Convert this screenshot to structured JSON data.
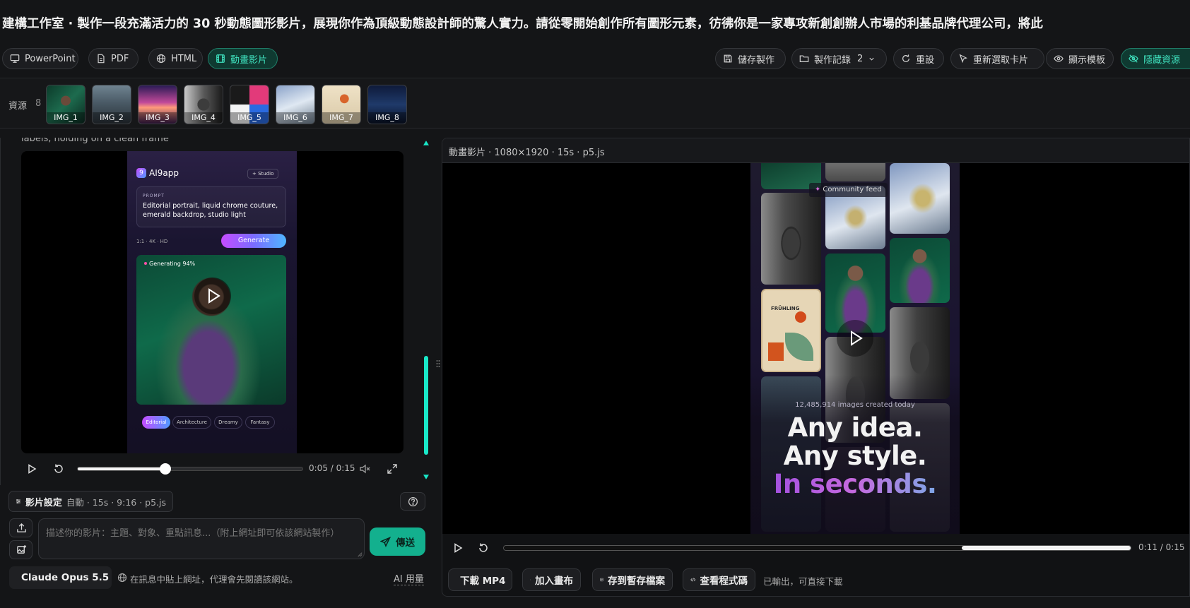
{
  "window": {
    "title": "建構工作室 · 製作一段充滿活力的 30 秒動態圖形影片，展現你作為頂級動態設計師的驚人實力。請從零開始創作所有圖形元素，彷彿你是一家專攻新創創辦人市場的利基品牌代理公司，將此"
  },
  "toolbar": {
    "formats": [
      {
        "label": "PowerPoint",
        "icon": "presentation-icon"
      },
      {
        "label": "PDF",
        "icon": "document-icon"
      },
      {
        "label": "HTML",
        "icon": "globe-icon"
      },
      {
        "label": "動畫影片",
        "icon": "film-icon",
        "active": true
      }
    ],
    "actions": [
      {
        "label": "儲存製作",
        "icon": "save-icon"
      },
      {
        "label": "製作記錄",
        "badge": "2",
        "icon": "folder-icon"
      },
      {
        "label": "重設",
        "icon": "refresh-icon"
      },
      {
        "label": "重新選取卡片",
        "icon": "pointer-icon"
      },
      {
        "label": "顯示模板",
        "icon": "eye-icon"
      },
      {
        "label": "隱藏資源",
        "icon": "eye-off-icon",
        "active": true
      }
    ]
  },
  "assets": {
    "label": "資源",
    "count": "8",
    "items": [
      "IMG_1",
      "IMG_2",
      "IMG_3",
      "IMG_4",
      "IMG_5",
      "IMG_6",
      "IMG_7",
      "IMG_8"
    ]
  },
  "chat_preview": {
    "caption": "labels, holding on a clean frame",
    "app_name": "AI9app",
    "app_badge": "9",
    "studio_chip": "+ Studio",
    "prompt_label": "PROMPT",
    "prompt_text": "Editorial portrait, liquid chrome couture, emerald backdrop, studio light",
    "specs": "1:1 · 4K · HD",
    "generate_label": "Generate",
    "generating": "Generating 94%",
    "style_tags": [
      "Editorial",
      "Architecture",
      "Dreamy",
      "Fantasy"
    ],
    "time": "0:05 / 0:15",
    "progress": 0.39
  },
  "settings": {
    "label": "影片設定",
    "value": "自動 · 15s · 9:16 · p5.js"
  },
  "composer": {
    "placeholder": "描述你的影片：主題、對象、重點訊息...（附上網址即可依該網站製作）",
    "send_label": "傳送",
    "model": "Claude Opus 5.5",
    "hint": "在訊息中貼上網址，代理會先閱讀該網站。",
    "usage": "AI 用量"
  },
  "video": {
    "header": "動畫影片 · 1080×1920 · 15s · p5.js",
    "community": "Community feed",
    "stat": "12,485,914 images created today",
    "headline_1": "Any idea.",
    "headline_2": "Any style.",
    "headline_3": "In seconds.",
    "time": "0:11 / 0:15",
    "progress": 0.73,
    "poster_text": "FRÜHLING"
  },
  "export": {
    "buttons": [
      "下載 MP4",
      "加入畫布",
      "存到暫存檔案",
      "查看程式碼"
    ],
    "status": "已輸出，可直接下載"
  },
  "colors": {
    "accent": "#3fe0bd",
    "send": "#13b08e",
    "generate_start": "#c64cff",
    "generate_end": "#4f9bff"
  }
}
